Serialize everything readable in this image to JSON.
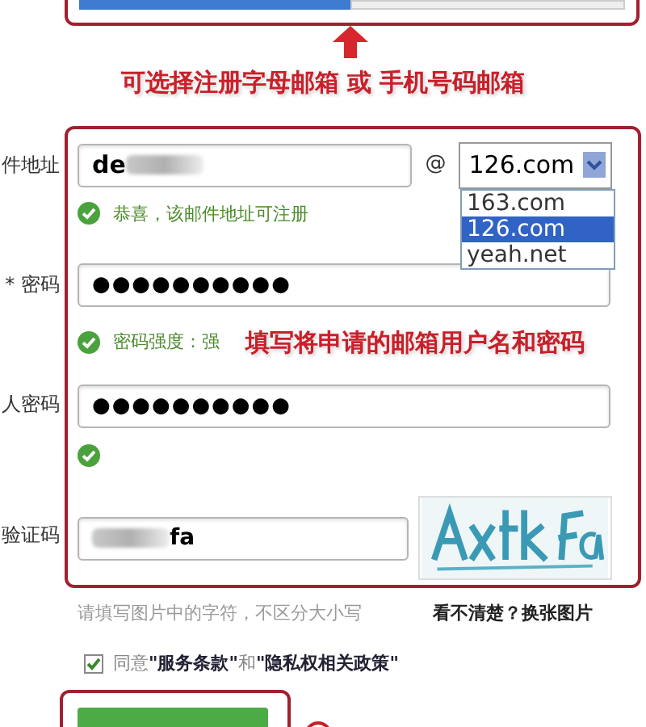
{
  "tabs": [
    {
      "selected": true
    },
    {
      "selected": false
    }
  ],
  "annotation_top": "可选择注册字母邮箱 或 手机号码邮箱",
  "email": {
    "label": "件地址",
    "value": "de",
    "at": "@",
    "domain": "126.com",
    "options": [
      {
        "label": "163.com",
        "selected": false
      },
      {
        "label": "126.com",
        "selected": true
      },
      {
        "label": "yeah.net",
        "selected": false
      }
    ],
    "message": "恭喜，该邮件地址可注册",
    "valid": true
  },
  "password": {
    "label": "* 密码",
    "value": "●●●●●●●●●●",
    "message": "密码强度：强",
    "valid": true
  },
  "annotation_middle": "填写将申请的邮箱用户名和密码",
  "confirm": {
    "label": "人密码",
    "value": "●●●●●●●●●●",
    "valid": true
  },
  "captcha": {
    "label": "验证码",
    "value": "fa",
    "hint": "请填写图片中的字符，不区分大小写",
    "refresh_link": "看不清楚？换张图片"
  },
  "agree": {
    "checked": true,
    "prefix": "同意",
    "terms": "\"服务条款\"",
    "middle": "和",
    "privacy": "\"隐私权相关政策\""
  }
}
